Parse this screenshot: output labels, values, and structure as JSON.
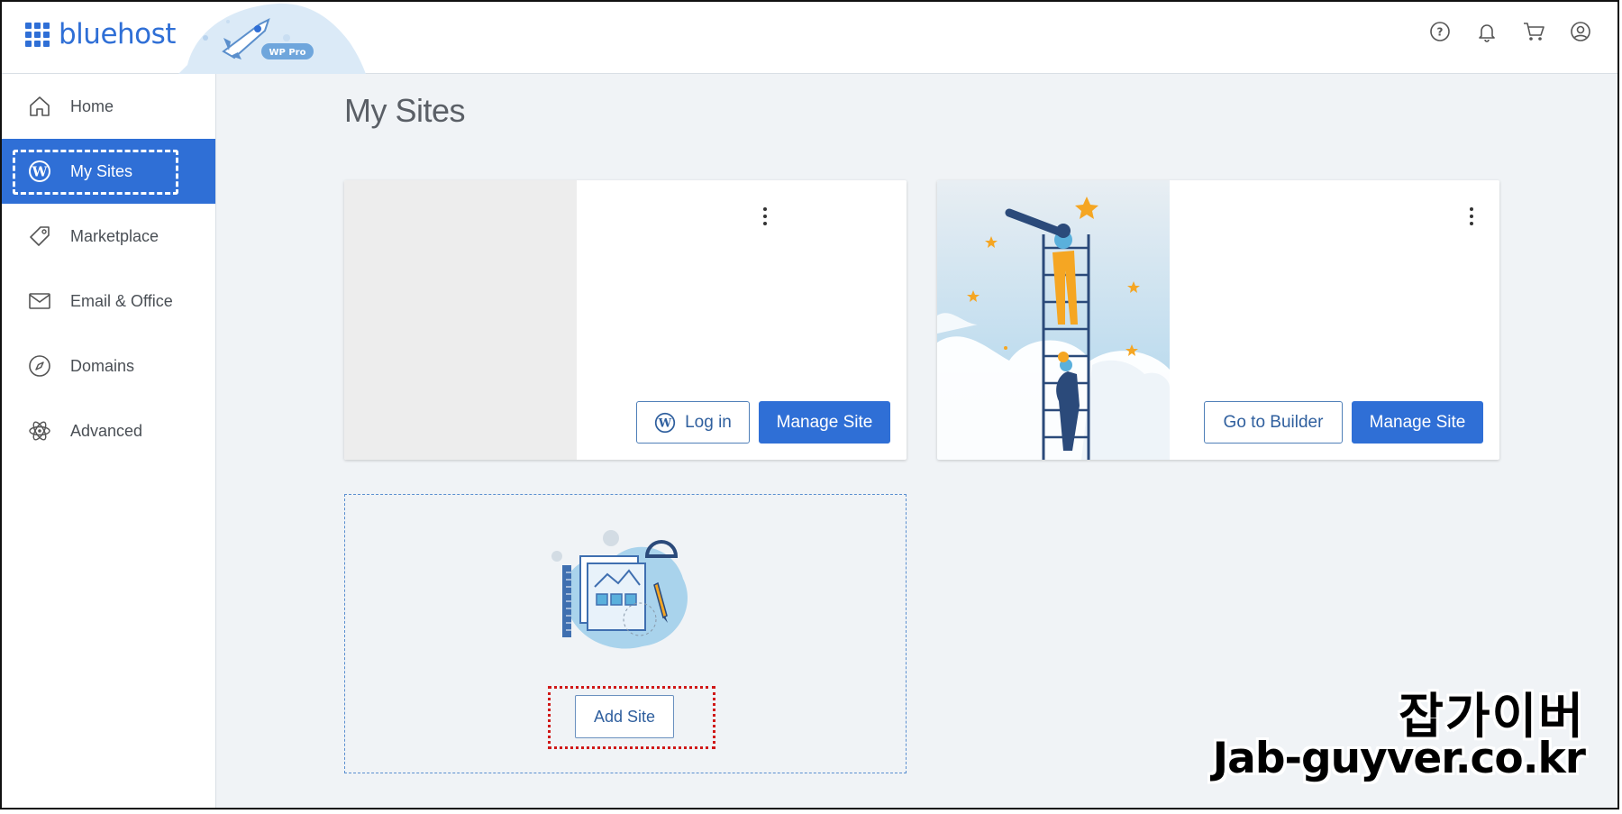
{
  "header": {
    "brand": "bluehost",
    "badge": "WP Pro",
    "icons": [
      "help-icon",
      "bell-icon",
      "cart-icon",
      "account-icon"
    ]
  },
  "sidebar": {
    "items": [
      {
        "label": "Home",
        "icon": "home-icon"
      },
      {
        "label": "My Sites",
        "icon": "wordpress-icon",
        "active": true
      },
      {
        "label": "Marketplace",
        "icon": "tag-icon"
      },
      {
        "label": "Email & Office",
        "icon": "envelope-icon"
      },
      {
        "label": "Domains",
        "icon": "compass-icon"
      },
      {
        "label": "Advanced",
        "icon": "atom-icon"
      }
    ]
  },
  "main": {
    "title": "My Sites",
    "sites": [
      {
        "secondary_button": "Log in",
        "primary_button": "Manage Site"
      },
      {
        "secondary_button": "Go to Builder",
        "primary_button": "Manage Site"
      }
    ],
    "add_site_label": "Add Site"
  },
  "watermark": {
    "korean": "잡가이버",
    "url": "Jab-guyver.co.kr"
  },
  "colors": {
    "accent": "#2f6fd6",
    "background": "#f0f3f6",
    "highlight_red": "#d01818"
  }
}
